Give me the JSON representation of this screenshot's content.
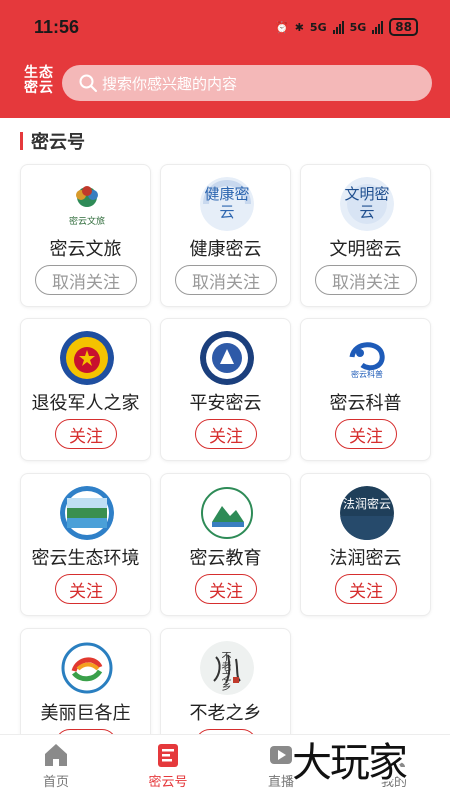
{
  "status": {
    "time": "11:56",
    "net1": "5G",
    "net2": "5G",
    "battery": "88"
  },
  "header": {
    "logo_text": "生态密云",
    "search_placeholder": "搜索你感兴趣的内容"
  },
  "section": {
    "title": "密云号"
  },
  "accounts": [
    {
      "name": "密云文旅",
      "button": "取消关注",
      "state": "unfollow",
      "emblem_text": "密云文旅"
    },
    {
      "name": "健康密云",
      "button": "取消关注",
      "state": "unfollow",
      "emblem_text": "健康密云"
    },
    {
      "name": "文明密云",
      "button": "取消关注",
      "state": "unfollow",
      "emblem_text": "文明密云"
    },
    {
      "name": "退役军人之家",
      "button": "关注",
      "state": "follow",
      "emblem_text": ""
    },
    {
      "name": "平安密云",
      "button": "关注",
      "state": "follow",
      "emblem_text": ""
    },
    {
      "name": "密云科普",
      "button": "关注",
      "state": "follow",
      "emblem_text": "密云科普"
    },
    {
      "name": "密云生态环境",
      "button": "关注",
      "state": "follow",
      "emblem_text": ""
    },
    {
      "name": "密云教育",
      "button": "关注",
      "state": "follow",
      "emblem_text": ""
    },
    {
      "name": "法润密云",
      "button": "关注",
      "state": "follow",
      "emblem_text": "法润密云"
    },
    {
      "name": "美丽巨各庄",
      "button": "关注",
      "state": "follow",
      "emblem_text": ""
    },
    {
      "name": "不老之乡",
      "button": "关注",
      "state": "follow",
      "emblem_text": "不老之乡"
    }
  ],
  "tabbar": [
    {
      "label": "首页",
      "icon": "home-icon",
      "active": false
    },
    {
      "label": "密云号",
      "icon": "document-icon",
      "active": true
    },
    {
      "label": "直播",
      "icon": "play-icon",
      "active": false
    },
    {
      "label": "我的",
      "icon": "person-icon",
      "active": false
    }
  ],
  "watermark": "大玩家",
  "colors": {
    "brand_red": "#e5393c",
    "follow_red": "#d62e2e",
    "unfollow_gray": "#999999"
  }
}
